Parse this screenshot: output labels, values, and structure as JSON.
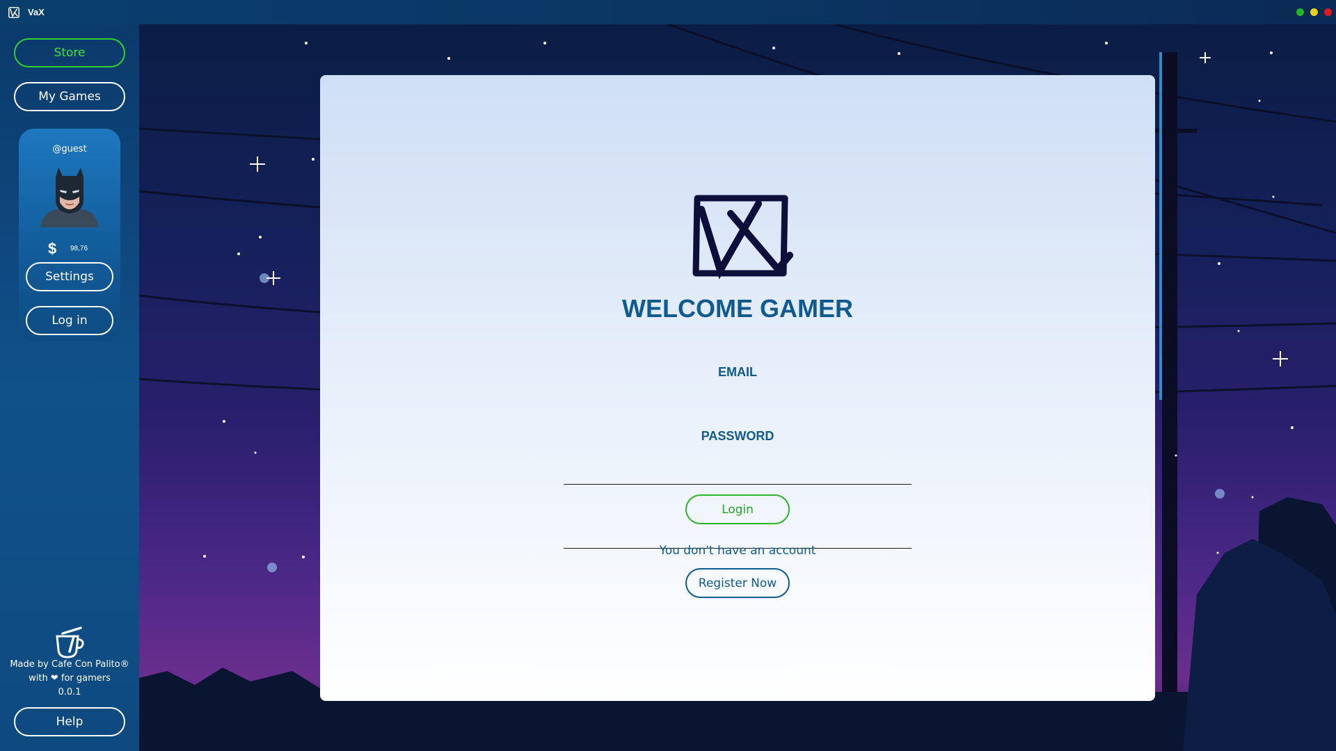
{
  "window": {
    "title": "VaX",
    "controls": [
      {
        "name": "minimize",
        "color": "#21b521"
      },
      {
        "name": "maximize",
        "color": "#e7d21b"
      },
      {
        "name": "close",
        "color": "#e01b1b"
      }
    ]
  },
  "sidebar": {
    "store_label": "Store",
    "my_games_label": "My Games",
    "profile": {
      "username": "@guest",
      "avatar_icon": "masked-hero-avatar",
      "currency_symbol": "$",
      "balance": "98,76"
    },
    "settings_label": "Settings",
    "login_label": "Log in",
    "footer": {
      "logo_icon": "cafe-con-palito-cup-icon",
      "made_by": "Made by Cafe Con Palito®",
      "with_love": "with ❤ for gamers",
      "version": "0.0.1"
    },
    "help_label": "Help"
  },
  "login_panel": {
    "logo_icon": "vax-logo",
    "heading": "WELCOME GAMER",
    "email_label": "EMAIL",
    "email_value": "",
    "password_label": "PASSWORD",
    "password_value": "",
    "login_button": "Login",
    "no_account_text": "You don't have an account",
    "register_button": "Register Now"
  },
  "colors": {
    "accent_green": "#2ed12e",
    "heading_blue": "#0f5a8e",
    "sidebar_blue": "#10518a"
  }
}
